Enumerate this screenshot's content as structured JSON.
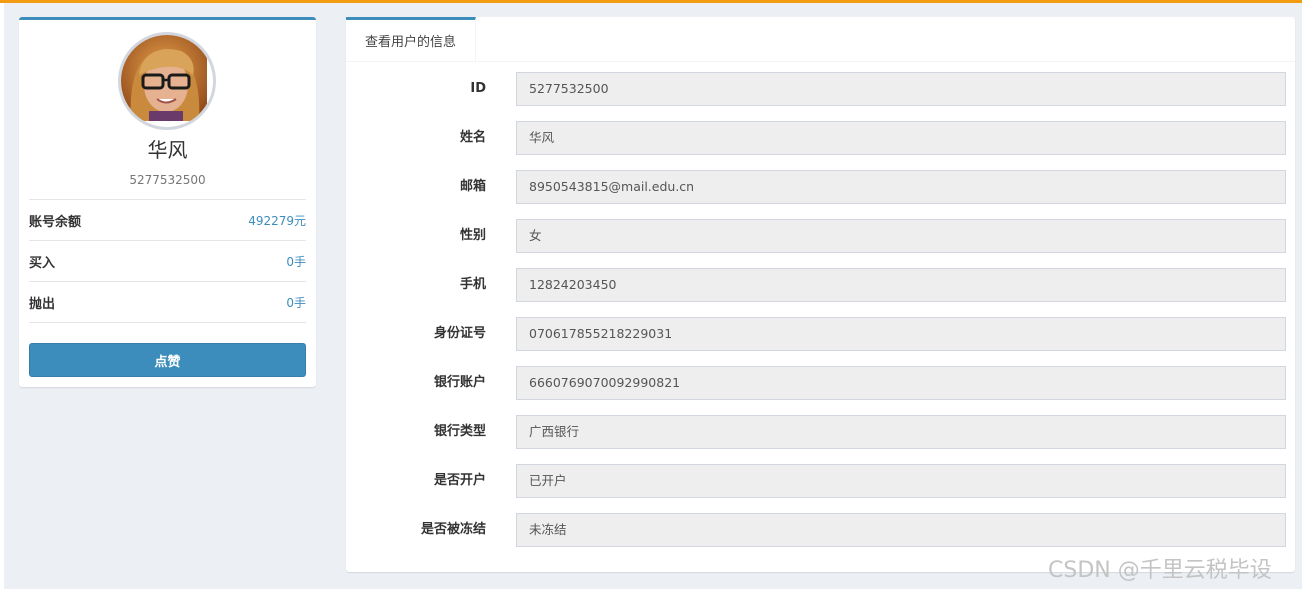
{
  "profile": {
    "name": "华风",
    "id": "5277532500",
    "stats": [
      {
        "label": "账号余额",
        "value": "492279元"
      },
      {
        "label": "买入",
        "value": "0手"
      },
      {
        "label": "抛出",
        "value": "0手"
      }
    ],
    "like_button": "点赞"
  },
  "panel": {
    "tab_label": "查看用户的信息",
    "fields": [
      {
        "label": "ID",
        "value": "5277532500"
      },
      {
        "label": "姓名",
        "value": "华风"
      },
      {
        "label": "邮箱",
        "value": "8950543815@mail.edu.cn"
      },
      {
        "label": "性别",
        "value": "女"
      },
      {
        "label": "手机",
        "value": "12824203450"
      },
      {
        "label": "身份证号",
        "value": "070617855218229031"
      },
      {
        "label": "银行账户",
        "value": "6660769070092990821"
      },
      {
        "label": "银行类型",
        "value": "广西银行"
      },
      {
        "label": "是否开户",
        "value": "已开户"
      },
      {
        "label": "是否被冻结",
        "value": "未冻结"
      }
    ]
  },
  "watermark": "CSDN @千里云税毕设",
  "colors": {
    "accent": "#3c8dbc",
    "topbar": "#f39c12",
    "background": "#ecf0f5"
  }
}
